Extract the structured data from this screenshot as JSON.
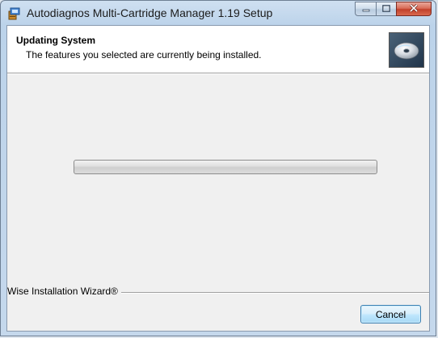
{
  "window": {
    "title": "Autodiagnos Multi-Cartridge Manager 1.19 Setup",
    "icon": "installer-icon",
    "controls": {
      "minimize_icon": "minimize-icon",
      "maximize_icon": "maximize-icon",
      "close_icon": "close-icon"
    }
  },
  "header": {
    "title": "Updating System",
    "subtitle": "The features you selected are currently being installed.",
    "icon": "cd-disc-icon"
  },
  "progress": {
    "fraction": 0.0
  },
  "footer": {
    "brand": "Wise Installation Wizard®",
    "cancel_label": "Cancel"
  },
  "colors": {
    "close_button": "#c2402a",
    "progress_track": "#d9d9d9",
    "cancel_border": "#3c7fb1"
  }
}
